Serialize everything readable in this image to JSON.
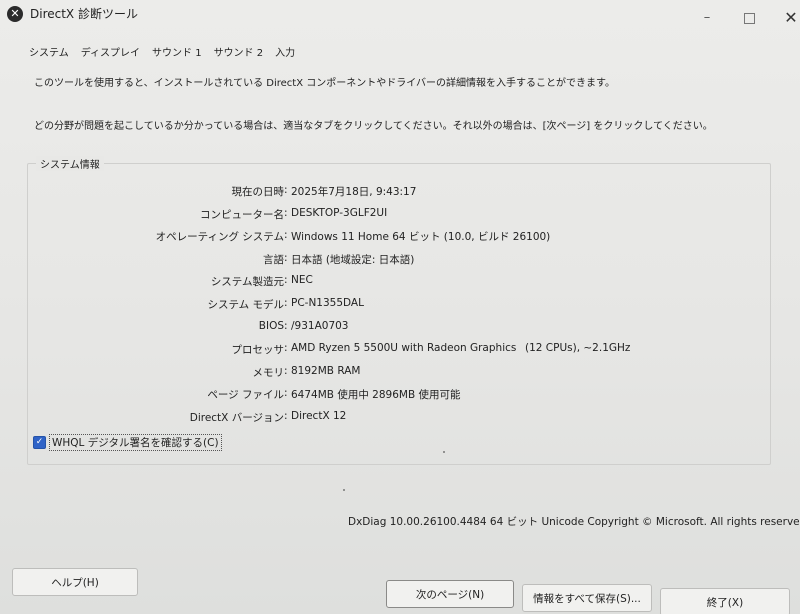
{
  "window": {
    "title": "DirectX 診断ツール",
    "minimize_label": "–",
    "close_label": "✕"
  },
  "tabs": [
    {
      "label": "システム"
    },
    {
      "label": "ディスプレイ"
    },
    {
      "label": "サウンド 1"
    },
    {
      "label": "サウンド 2"
    },
    {
      "label": "入力"
    }
  ],
  "intro": {
    "line1": "このツールを使用すると、インストールされている DirectX コンポーネントやドライバーの詳細情報を入手することができます。",
    "line2": "どの分野が問題を起こしているか分かっている場合は、適当なタブをクリックしてください。それ以外の場合は、[次ページ] をクリックしてください。"
  },
  "system_info": {
    "group_title": "システム情報",
    "rows": [
      {
        "label": "現在の日時",
        "value": "2025年7月18日, 9:43:17"
      },
      {
        "label": "コンピューター名",
        "value": "DESKTOP-3GLF2UI"
      },
      {
        "label": "オペレーティング システム",
        "value": "Windows 11 Home 64 ビット (10.0, ビルド 26100)"
      },
      {
        "label": "言語",
        "value": "日本語 (地域設定: 日本語)"
      },
      {
        "label": "システム製造元",
        "value": "NEC"
      },
      {
        "label": "システム モデル",
        "value": "PC-N1355DAL"
      },
      {
        "label": "BIOS",
        "value": "/931A0703"
      },
      {
        "label": "プロセッサ",
        "value": "AMD Ryzen 5 5500U with Radeon Graphics",
        "extra": "(12 CPUs), ~2.1GHz"
      },
      {
        "label": "メモリ",
        "value": "8192MB RAM"
      },
      {
        "label": "ページ ファイル",
        "value": "6474MB 使用中 2896MB 使用可能"
      },
      {
        "label": "DirectX バージョン",
        "value": "DirectX 12"
      }
    ],
    "separator": ":"
  },
  "whql_checkbox": {
    "label": "WHQL デジタル署名を確認する(C)",
    "checked": true,
    "check_glyph": "✓"
  },
  "copyright": "DxDiag 10.00.26100.4484 64 ビット Unicode  Copyright © Microsoft. All rights reserved.",
  "buttons": {
    "help": "ヘルプ(H)",
    "next": "次のページ(N)",
    "save_all": "情報をすべて保存(S)...",
    "exit": "終了(X)"
  },
  "colors": {
    "accent": "#2f63c7",
    "background": "#e6e6e4"
  }
}
